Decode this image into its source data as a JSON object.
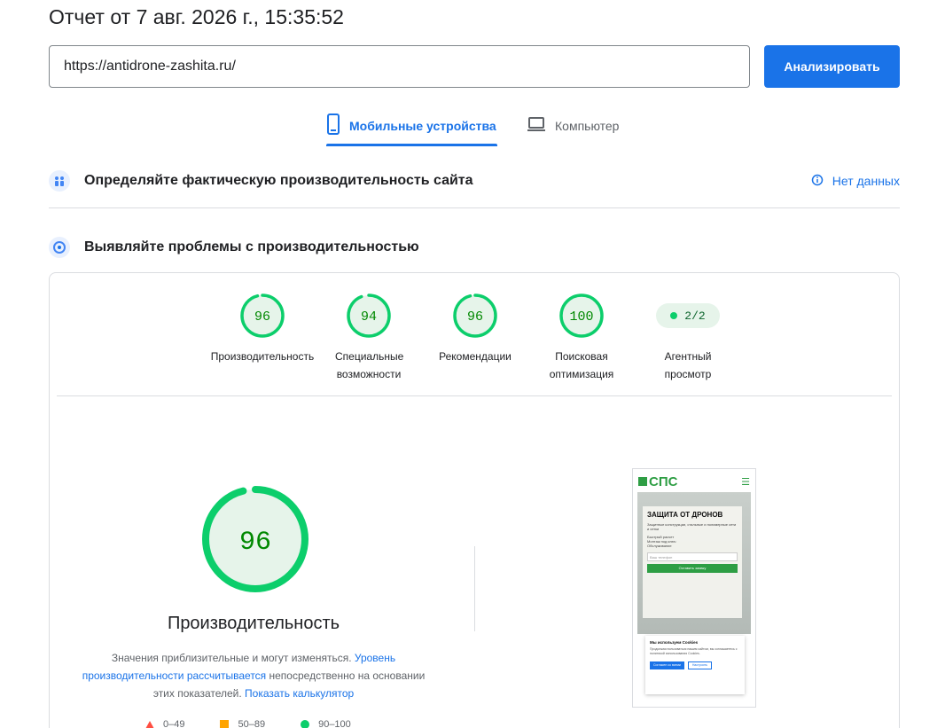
{
  "report": {
    "title": "Отчет от 7 авг. 2026 г., 15:35:52"
  },
  "search": {
    "url_value": "https://antidrone-zashita.ru/",
    "analyze_label": "Анализировать"
  },
  "tabs": [
    {
      "label": "Мобильные устройства",
      "icon": "phone-icon",
      "active": true
    },
    {
      "label": "Компьютер",
      "icon": "laptop-icon",
      "active": false
    }
  ],
  "sections": {
    "field_data": {
      "title": "Определяйте фактическую производительность сайта",
      "no_data_label": "Нет данных"
    },
    "lab_data": {
      "title": "Выявляйте проблемы с производительностью"
    }
  },
  "categories": [
    {
      "score": 96,
      "label": "Производительность"
    },
    {
      "score": 94,
      "label": "Специальные возможности"
    },
    {
      "score": 96,
      "label": "Рекомендации"
    },
    {
      "score": 100,
      "label": "Поисковая оптимизация"
    },
    {
      "pill": "2/2",
      "label": "Агентный просмотр"
    }
  ],
  "performance": {
    "score": 96,
    "title": "Производительность",
    "desc_part1": "Значения приблизительные и могут изменяться. ",
    "desc_link1": "Уровень производительности рассчитывается",
    "desc_part2": " непосредственно на основании этих показателей. ",
    "desc_link2": "Показать калькулятор"
  },
  "legend": {
    "fail": "0–49",
    "average": "50–89",
    "pass": "90–100"
  },
  "thumbnail": {
    "logo": "СПС",
    "heading": "ЗАЩИТА ОТ ДРОНОВ",
    "sub": "Защитные конструкции, стальные и полимерные сети и сетки",
    "bullets": [
      "Быстрый расчет",
      "Монтаж под ключ",
      "Обслуживание"
    ],
    "phone_placeholder": "Ваш телефон",
    "cta": "Оставить заявку",
    "cookie_title": "Мы используем Cookies",
    "cookie_text": "Продолжая пользоваться нашим сайтом, вы соглашаетесь с политикой использования Cookies.",
    "cookie_accept": "Согласен со всеми",
    "cookie_settings": "Настроить"
  },
  "colors": {
    "pass": "#0cce6b",
    "pass_bg": "#e6f4ea",
    "pass_text": "#008800",
    "accent": "#1a73e8"
  }
}
